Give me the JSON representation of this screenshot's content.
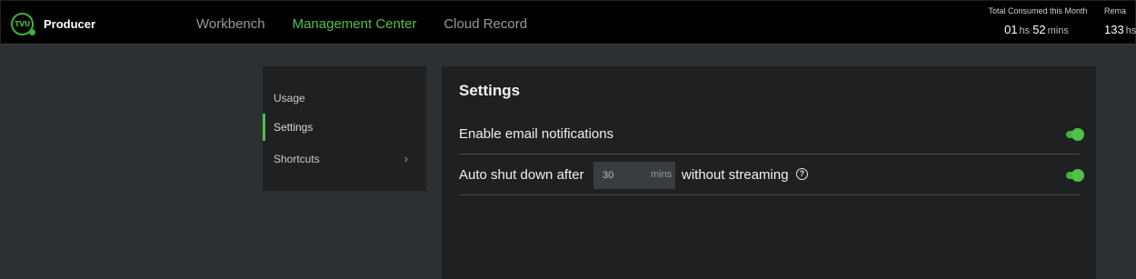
{
  "header": {
    "logo_text": "TVU",
    "app_name": "Producer",
    "nav": [
      {
        "label": "Workbench",
        "active": false
      },
      {
        "label": "Management Center",
        "active": true
      },
      {
        "label": "Cloud Record",
        "active": false
      }
    ],
    "consumed": {
      "label": "Total Consumed this Month",
      "hours": "01",
      "hours_unit": "hs",
      "minutes": "52",
      "minutes_unit": "mins"
    },
    "remaining": {
      "label": "Rema",
      "hours": "133",
      "hours_unit": "hs"
    }
  },
  "sidebar": {
    "items": [
      {
        "label": "Usage",
        "active": false
      },
      {
        "label": "Settings",
        "active": true
      },
      {
        "label": "Shortcuts",
        "active": false,
        "has_submenu": true
      }
    ]
  },
  "settings": {
    "title": "Settings",
    "email_notifications": {
      "label": "Enable email notifications",
      "enabled": true
    },
    "auto_shutdown": {
      "label_before": "Auto shut down after",
      "value": "30",
      "unit": "mins",
      "label_after": "without streaming",
      "enabled": true
    }
  },
  "colors": {
    "accent": "#4fc04a",
    "topbar_bg": "#000000",
    "page_bg": "#2d3033",
    "panel_bg": "#1e2022"
  }
}
